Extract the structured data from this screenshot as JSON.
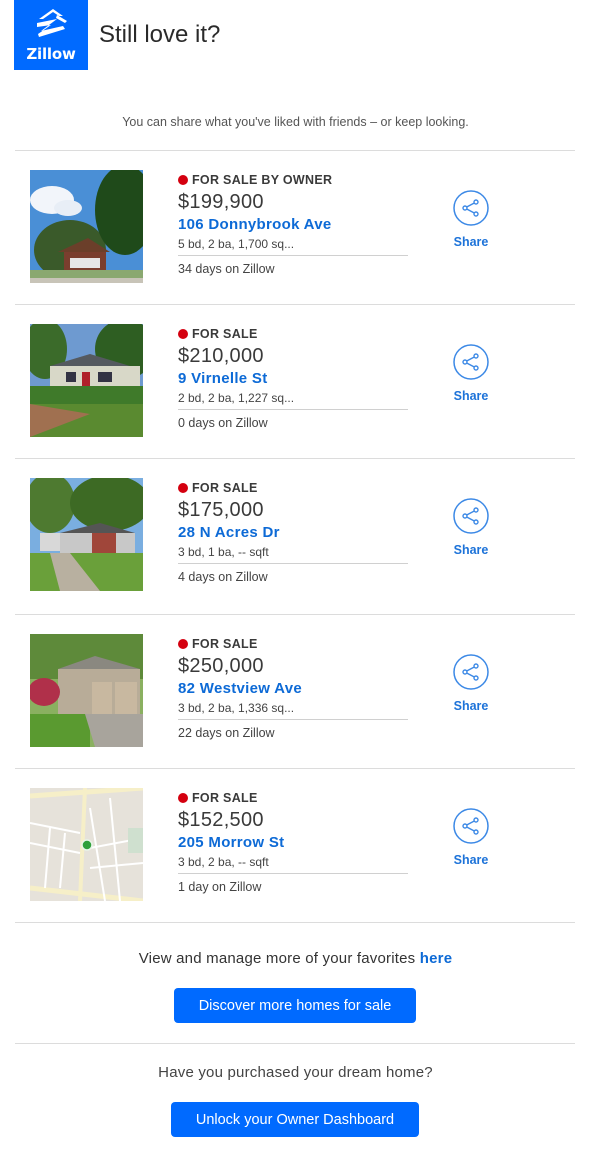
{
  "header": {
    "logo_text": "Zillow",
    "title": "Still love it?"
  },
  "subtitle": "You can share what you've liked with friends – or keep looking.",
  "colors": {
    "brand_blue": "#006aff",
    "link_blue": "#0d6ad6",
    "status_red": "#d4000f"
  },
  "listings": [
    {
      "status": "FOR SALE BY OWNER",
      "price": "$199,900",
      "address": "106 Donnybrook Ave",
      "facts": "5 bd, 2 ba, 1,700 sq...",
      "days": "34 days on Zillow",
      "share_label": "Share",
      "photo": "house-photo"
    },
    {
      "status": "FOR SALE",
      "price": "$210,000",
      "address": "9 Virnelle St",
      "facts": "2 bd, 2 ba, 1,227 sq...",
      "days": "0 days on Zillow",
      "share_label": "Share",
      "photo": "house-photo"
    },
    {
      "status": "FOR SALE",
      "price": "$175,000",
      "address": "28 N Acres Dr",
      "facts": "3 bd, 1 ba, -- sqft",
      "days": "4 days on Zillow",
      "share_label": "Share",
      "photo": "house-photo"
    },
    {
      "status": "FOR SALE",
      "price": "$250,000",
      "address": "82 Westview Ave",
      "facts": "3 bd, 2 ba, 1,336 sq...",
      "days": "22 days on Zillow",
      "share_label": "Share",
      "photo": "house-photo"
    },
    {
      "status": "FOR SALE",
      "price": "$152,500",
      "address": "205 Morrow St",
      "facts": "3 bd, 2 ba, -- sqft",
      "days": "1 day on Zillow",
      "share_label": "Share",
      "photo": "map-thumbnail"
    }
  ],
  "footer": {
    "manage_text": "View and manage more of your favorites",
    "manage_link": "here",
    "discover_button": "Discover more homes for sale",
    "purchased_text": "Have you purchased your dream home?",
    "unlock_button": "Unlock your Owner Dashboard"
  }
}
